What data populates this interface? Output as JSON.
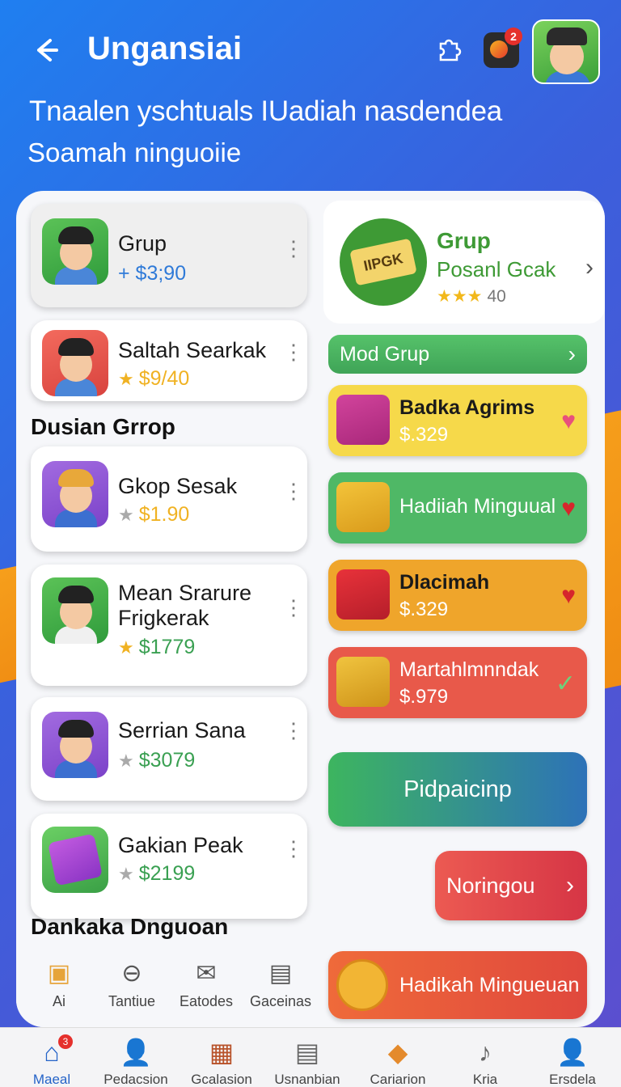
{
  "header": {
    "title": "Ungansiai",
    "back_icon": "arrow-left-icon",
    "notification_badge": "2"
  },
  "hero": {
    "headline": "Tnaalen yschtuals IUadiah nasdendea",
    "subhead": "Soamah ninguoiie"
  },
  "left_cards": [
    {
      "title": "Grup",
      "price": "+ $3;90",
      "price_color": "#2f7ad8",
      "star": false
    },
    {
      "title": "Saltah Searkak",
      "price": "$9/40",
      "price_color": "#f0b223",
      "star": true,
      "star_color": "#f0b223"
    },
    {
      "title": "Gkop Sesak",
      "price": "$1.90",
      "price_color": "#f0b223",
      "star": true,
      "star_color": "#aaaaaa"
    },
    {
      "title": "Mean Srarure Frigkerak",
      "price": "$1779",
      "price_color": "#3aa052",
      "star": true,
      "star_color": "#f0b223"
    },
    {
      "title": "Serrian Sana",
      "price": "$3079",
      "price_color": "#3aa052",
      "star": true,
      "star_color": "#aaaaaa"
    },
    {
      "title": "Gakian Peak",
      "price": "$2199",
      "price_color": "#3aa052",
      "star": true,
      "star_color": "#aaaaaa"
    }
  ],
  "sections": {
    "dusian": "Dusian Grrop",
    "dankaka": "Dankaka Dnguoan"
  },
  "featured": {
    "title": "Grup",
    "subtitle": "Posanl Gcak",
    "rating": "40",
    "ticket_text": "IIPGK"
  },
  "mod_button": "Mod Grup",
  "gifts": [
    {
      "title": "Badka Agrims",
      "price": "$.329",
      "bg": "#f6d94a",
      "title_color": "#1a1a1a",
      "mark": "heart",
      "mark_color": "#e8507c"
    },
    {
      "title": "Hadiiah Minguual",
      "price": "",
      "bg": "#4fb866",
      "title_color": "#ffffff",
      "mark": "heart",
      "mark_color": "#d6262c"
    },
    {
      "title": "Dlacimah",
      "price": "$.329",
      "bg": "#efa52b",
      "title_color": "#1a1a1a",
      "mark": "heart",
      "mark_color": "#d6262c"
    },
    {
      "title": "Martahlmnndak",
      "price": "$.979",
      "bg": "#e8594a",
      "title_color": "#ffffff",
      "mark": "check",
      "mark_color": "#6fd07a"
    }
  ],
  "pidp_button": "Pidpaicinp",
  "noringou_button": "Noringou",
  "hadikah_button": "Hadikah Mingueuan",
  "mini_tabs": [
    {
      "label": "Ai",
      "icon": "gift-box-icon"
    },
    {
      "label": "Tantiue",
      "icon": "back-circle-icon"
    },
    {
      "label": "Eatodes",
      "icon": "mail-icon"
    },
    {
      "label": "Gaceinas",
      "icon": "device-icon"
    }
  ],
  "bottom_nav": [
    {
      "label": "Maeal",
      "icon": "home-icon",
      "badge": "3",
      "active": true
    },
    {
      "label": "Pedacsion",
      "icon": "person-icon"
    },
    {
      "label": "Gcalasion",
      "icon": "box-icon"
    },
    {
      "label": "Usnanbian",
      "icon": "document-icon"
    },
    {
      "label": "Cariarion",
      "icon": "tool-icon"
    },
    {
      "label": "Kria",
      "icon": "guitar-icon"
    },
    {
      "label": "Ersdela",
      "icon": "person-icon"
    }
  ]
}
